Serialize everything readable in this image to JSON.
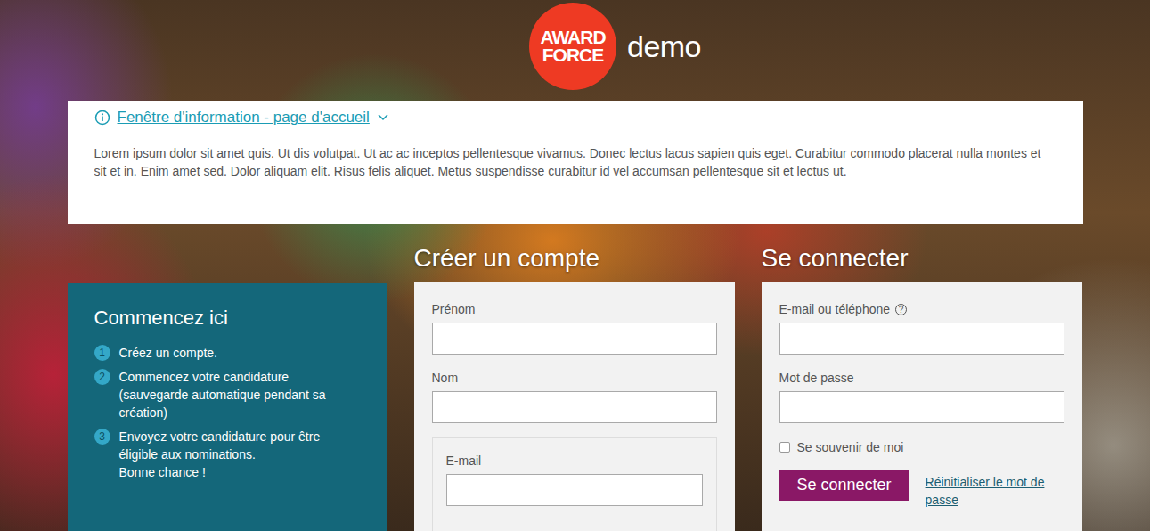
{
  "logo": {
    "mark": [
      "AWARD",
      "FORCE"
    ],
    "suffix": "demo"
  },
  "info": {
    "title": "Fenêtre d'information - page d'accueil",
    "expanded": true,
    "body": "Lorem ipsum dolor sit amet quis. Ut dis volutpat. Ut ac ac inceptos pellentesque vivamus. Donec lectus lacus sapien quis eget. Curabitur commodo placerat nulla montes et sit et in. Enim amet sed. Dolor aliquam elit. Risus felis aliquet. Metus suspendisse curabitur id vel accumsan pellentesque sit et lectus ut."
  },
  "start": {
    "title": "Commencez ici",
    "steps": [
      {
        "number": "1",
        "text": "Créez un compte.",
        "note": ""
      },
      {
        "number": "2",
        "text": "Commencez votre candidature (sauvegarde automatique pendant sa création)",
        "note": ""
      },
      {
        "number": "3",
        "text": "Envoyez votre candidature pour être éligible aux nominations.",
        "note": "Bonne chance !"
      }
    ]
  },
  "register": {
    "title": "Créer un compte",
    "fields": [
      {
        "label": "Prénom"
      },
      {
        "label": "Nom"
      }
    ],
    "email": {
      "label": "E-mail"
    }
  },
  "login": {
    "title": "Se connecter",
    "fields": [
      {
        "label": "E-mail ou téléphone",
        "hint": "?"
      },
      {
        "label": "Mot de passe",
        "hint": ""
      }
    ],
    "remember": {
      "label": "Se souvenir de moi",
      "checked": false
    },
    "submit": "Se connecter",
    "reset": "Réinitialiser le mot de passe"
  }
}
